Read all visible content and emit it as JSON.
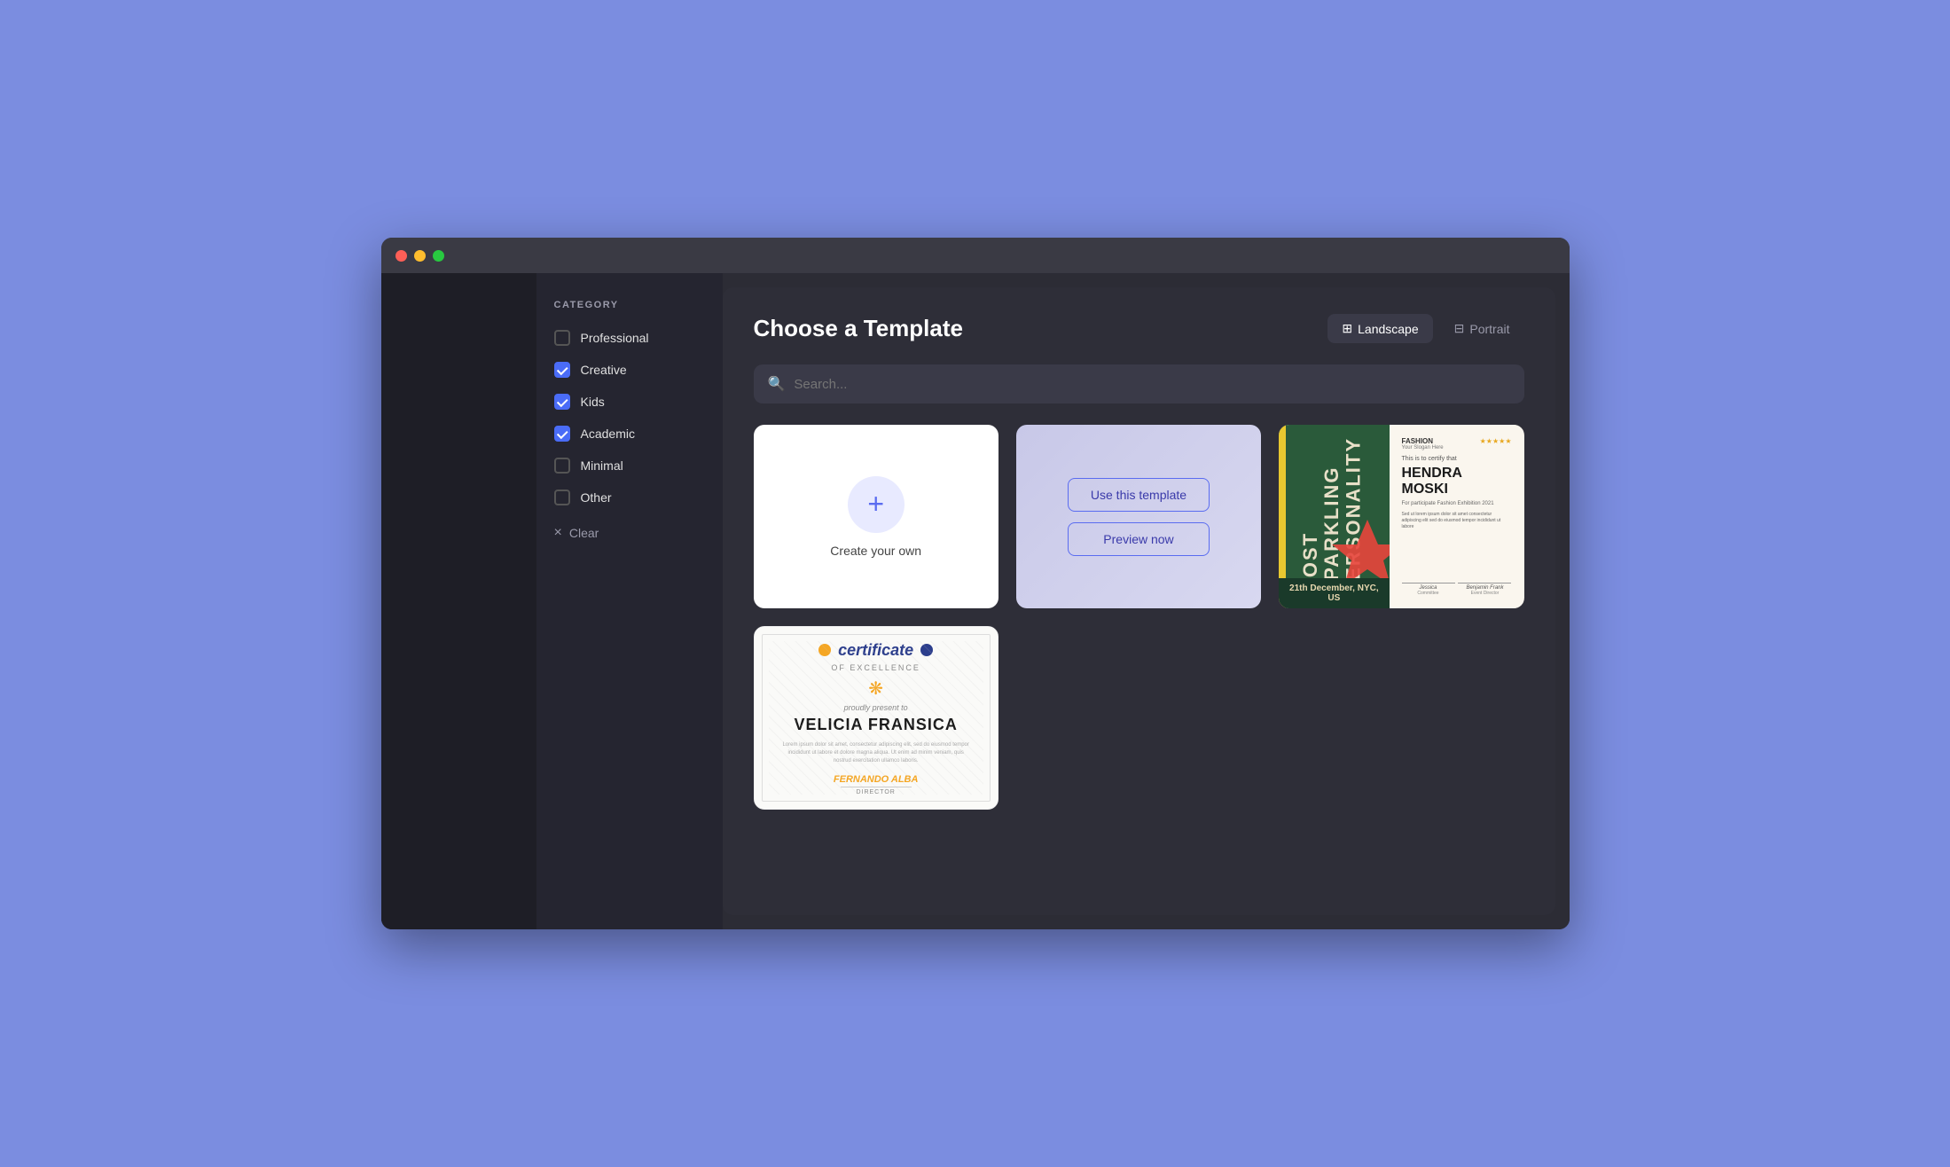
{
  "browser": {
    "title": "Choose a Template"
  },
  "sidebar": {
    "placeholder": ""
  },
  "filter": {
    "category_label": "CATEGORY",
    "items": [
      {
        "label": "Professional",
        "checked": false,
        "id": "professional"
      },
      {
        "label": "Creative",
        "checked": true,
        "id": "creative"
      },
      {
        "label": "Kids",
        "checked": true,
        "id": "kids"
      },
      {
        "label": "Academic",
        "checked": true,
        "id": "academic"
      },
      {
        "label": "Minimal",
        "checked": false,
        "id": "minimal"
      },
      {
        "label": "Other",
        "checked": false,
        "id": "other"
      }
    ],
    "clear_label": "Clear"
  },
  "main": {
    "title": "Choose a Template",
    "view_buttons": [
      {
        "label": "Landscape",
        "active": true,
        "id": "landscape"
      },
      {
        "label": "Portrait",
        "active": false,
        "id": "portrait"
      }
    ],
    "search_placeholder": "Search...",
    "create_own_label": "Create your own",
    "template_actions": {
      "use_label": "Use this template",
      "preview_label": "Preview now"
    },
    "fashion_template": {
      "left_text": "MOST SPARKLING PERSONALITY",
      "yellow_bar": true,
      "brand": "FASHION",
      "brand_sub": "Your Slogan Here",
      "stars": "★★★★★",
      "certify": "This is to certify that",
      "name": "HENDRA MOSKI",
      "for_text": "For participate Fashion Exhibition 2021",
      "date_text": "21th December, NYC, US",
      "sig1_name": "Jessica",
      "sig1_role": "Committee",
      "sig2_name": "Benjamin Frank",
      "sig2_role": "Event Director"
    },
    "certificate_template": {
      "title": "certificate",
      "of_excellence": "OF EXCELLENCE",
      "presented": "proudly present to",
      "name": "VELICIA FRANSICA",
      "sig_name": "FERNANDO ALBA",
      "sig_role": "Director"
    }
  }
}
